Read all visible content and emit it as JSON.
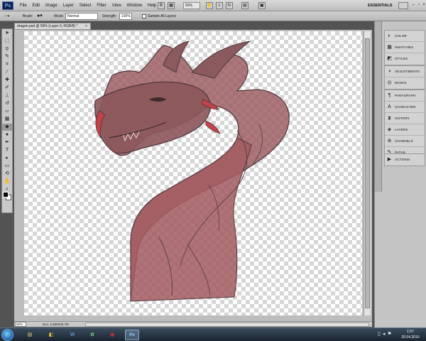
{
  "app": {
    "logo": "Ps",
    "menus": [
      "File",
      "Edit",
      "Image",
      "Layer",
      "Select",
      "Filter",
      "View",
      "Window",
      "Help"
    ],
    "zoom": "50%",
    "workspace": "ESSENTIALS"
  },
  "options_bar": {
    "tool_label": "Brush:",
    "mode_label": "Mode:",
    "mode_value": "Normal",
    "strength_label": "Strength:",
    "strength_value": "100%",
    "sample_all_layers": "Sample All Layers"
  },
  "document": {
    "tab_title": "dragon.psd @ 50% (Layer 0, RGB/8) *",
    "close": "×",
    "status_zoom": "50%",
    "status_info": "Doc: 2,93M/30,7M"
  },
  "panels": {
    "group1": [
      {
        "icon": "color-icon",
        "label": "COLOR"
      },
      {
        "icon": "swatches-icon",
        "label": "SWATCHES"
      },
      {
        "icon": "styles-icon",
        "label": "STYLES"
      }
    ],
    "group2": [
      {
        "icon": "adjustments-icon",
        "label": "ADJUSTMENTS"
      },
      {
        "icon": "masks-icon",
        "label": "MASKS"
      }
    ],
    "group3": [
      {
        "icon": "paragraph-icon",
        "label": "PARAGRAPH"
      },
      {
        "icon": "character-icon",
        "label": "CHARACTER"
      },
      {
        "icon": "history-icon",
        "label": "HISTORY"
      },
      {
        "icon": "layers-icon",
        "label": "LAYERS"
      },
      {
        "icon": "channels-icon",
        "label": "CHANNELS"
      },
      {
        "icon": "paths-icon",
        "label": "PATHS"
      }
    ],
    "group4": [
      {
        "icon": "actions-icon",
        "label": "ACTIONS"
      }
    ]
  },
  "taskbar": {
    "time": "1:57",
    "date": "20.04.2010"
  },
  "colors": {
    "dragon_fill": "#9a5a5e",
    "dragon_stroke": "#4e3538",
    "accent_red": "#c4424a"
  }
}
